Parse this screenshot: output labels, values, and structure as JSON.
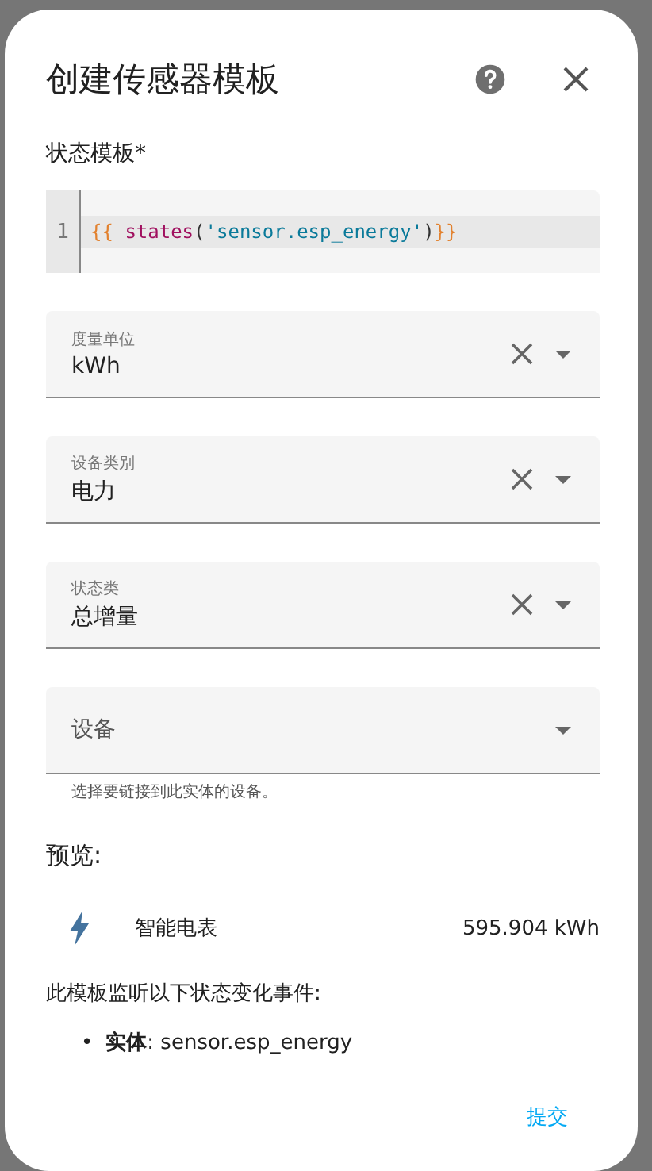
{
  "dialog": {
    "title": "创建传感器模板",
    "template_label": "状态模板*",
    "code": {
      "line_number": "1",
      "tokens": [
        {
          "kind": "bracket",
          "text": "{{ "
        },
        {
          "kind": "function",
          "text": "states"
        },
        {
          "kind": "punct",
          "text": "("
        },
        {
          "kind": "string",
          "text": "'sensor.esp_energy'"
        },
        {
          "kind": "punct",
          "text": ")"
        },
        {
          "kind": "bracket",
          "text": "}}"
        }
      ]
    },
    "fields": [
      {
        "label": "度量单位",
        "value": "kWh",
        "clearable": true
      },
      {
        "label": "设备类别",
        "value": "电力",
        "clearable": true
      },
      {
        "label": "状态类",
        "value": "总增量",
        "clearable": true
      },
      {
        "label": "设备",
        "clearable": false,
        "helper": "选择要链接到此实体的设备。"
      }
    ],
    "preview_label": "预览:",
    "preview": {
      "name": "智能电表",
      "state": "595.904 kWh"
    },
    "listen_label": "此模板监听以下状态变化事件:",
    "listeners": [
      {
        "bullet": "•",
        "key": "实体",
        "value": ": sensor.esp_energy"
      }
    ],
    "submit": "提交"
  }
}
